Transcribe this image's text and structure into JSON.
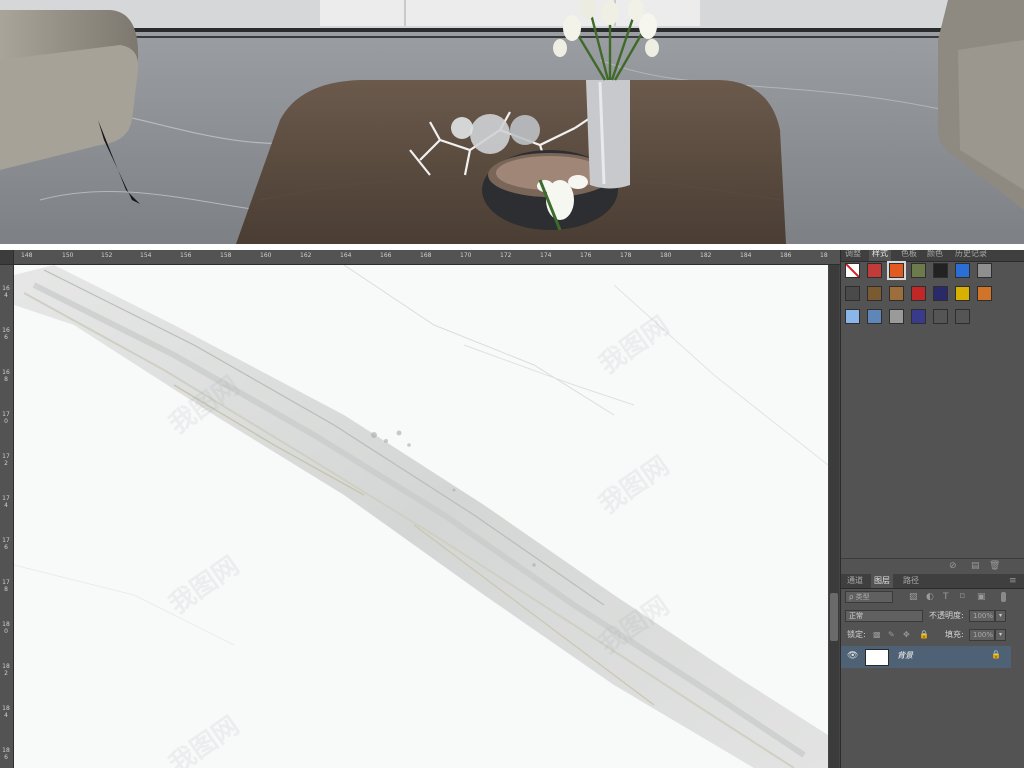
{
  "preview": {
    "scene": "living-room-render"
  },
  "ruler": {
    "top_ticks": [
      "148",
      "150",
      "152",
      "154",
      "156",
      "158",
      "160",
      "162",
      "164",
      "166",
      "168",
      "170",
      "172",
      "174",
      "176",
      "178",
      "180",
      "182",
      "184",
      "186",
      "18"
    ],
    "left_ticks": [
      "164",
      "166",
      "168",
      "170",
      "172",
      "174",
      "176",
      "178",
      "180",
      "182",
      "184",
      "186"
    ]
  },
  "watermark": {
    "text": "我图网"
  },
  "styles_panel": {
    "tabs": [
      "调整",
      "样式",
      "色板",
      "颜色",
      "历史记录"
    ],
    "active_tab": "样式",
    "swatch_colors": [
      "#c23b3b",
      "#e25a1f",
      "#6d7a4c",
      "#222222",
      "#2b6fd6",
      "#8f8f8f",
      "#4a4a4a",
      "#7a5a30",
      "#9c6e3c",
      "#c02828",
      "#2a2a6a",
      "#d8b000",
      "#d0742a",
      "#8ab6e8",
      "#5f86b8",
      "#9a9a9a",
      "#3a3a8a",
      "#555555",
      "#555555",
      "#555555"
    ]
  },
  "layers_panel": {
    "tabs": [
      "通道",
      "图层",
      "路径"
    ],
    "active_tab": "图层",
    "filter_label": "ρ 类型",
    "filter_icons": [
      "image-filter-icon",
      "adjustment-filter-icon",
      "type-filter-icon",
      "shape-filter-icon",
      "smart-filter-icon"
    ],
    "filter_glyphs": [
      "▨",
      "◐",
      "T",
      "⌑",
      "▣"
    ],
    "blend_mode": "正常",
    "opacity_label": "不透明度:",
    "opacity_value": "100%",
    "lock_label": "锁定:",
    "fill_label": "填充:",
    "fill_value": "100%",
    "layers": [
      {
        "name": "背景",
        "visible": true,
        "locked": true
      }
    ]
  }
}
